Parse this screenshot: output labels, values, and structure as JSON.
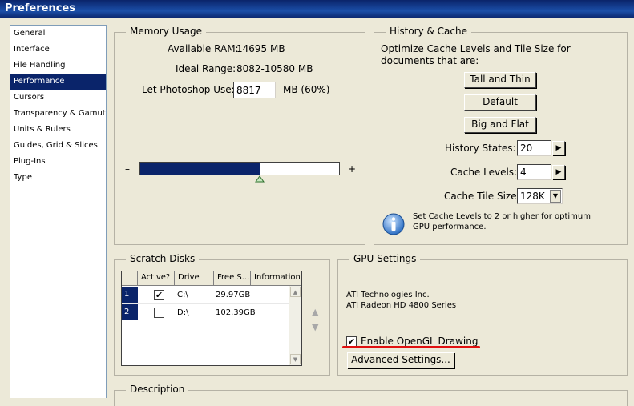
{
  "window": {
    "title": "Preferences"
  },
  "sidebar": {
    "items": [
      {
        "label": "General"
      },
      {
        "label": "Interface"
      },
      {
        "label": "File Handling"
      },
      {
        "label": "Performance"
      },
      {
        "label": "Cursors"
      },
      {
        "label": "Transparency & Gamut"
      },
      {
        "label": "Units & Rulers"
      },
      {
        "label": "Guides, Grid & Slices"
      },
      {
        "label": "Plug-Ins"
      },
      {
        "label": "Type"
      }
    ],
    "selected": "Performance"
  },
  "memory": {
    "legend": "Memory Usage",
    "available_label": "Available RAM:",
    "available_value": "14695 MB",
    "ideal_label": "Ideal Range:",
    "ideal_value": "8082-10580 MB",
    "let_label": "Let Photoshop Use:",
    "let_value": "8817",
    "let_unit": "MB (60%)",
    "slider_minus": "–",
    "slider_plus": "+",
    "slider_fraction": 0.6
  },
  "history": {
    "legend": "History & Cache",
    "description": "Optimize Cache Levels and Tile Size for documents that are:",
    "btn_tall_thin": "Tall and Thin",
    "btn_default": "Default",
    "btn_big_flat": "Big and Flat",
    "history_states_label": "History States:",
    "history_states_value": "20",
    "cache_levels_label": "Cache Levels:",
    "cache_levels_value": "4",
    "tile_size_label": "Cache Tile Size:",
    "tile_size_value": "128K",
    "info_text": "Set Cache Levels to 2 or higher for optimum GPU performance."
  },
  "scratch": {
    "legend": "Scratch Disks",
    "columns": [
      "Active?",
      "Drive",
      "Free S...",
      "Information"
    ],
    "rows": [
      {
        "num": "1",
        "active": true,
        "drive": "C:\\",
        "free": "29.97GB",
        "info": ""
      },
      {
        "num": "2",
        "active": false,
        "drive": "D:\\",
        "free": "102.39GB",
        "info": ""
      }
    ]
  },
  "gpu": {
    "legend": "GPU Settings",
    "vendor": "ATI Technologies Inc.",
    "model": "ATI Radeon HD 4800 Series",
    "opengl_label": "Enable OpenGL Drawing",
    "opengl_checked": true,
    "advanced_label": "Advanced Settings..."
  },
  "description": {
    "legend": "Description"
  },
  "colors": {
    "selection": "#0a246a",
    "annotation": "#e01010",
    "face": "#ece9d8"
  },
  "icons": {
    "info": "info-icon",
    "check": "check-icon"
  }
}
